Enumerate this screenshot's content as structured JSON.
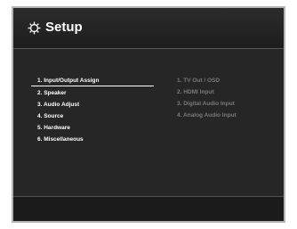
{
  "header": {
    "title": "Setup",
    "icon": "gear-icon"
  },
  "main_menu": {
    "selected_index": 0,
    "items": [
      {
        "label": "1. Input/Output Assign"
      },
      {
        "label": "2. Speaker"
      },
      {
        "label": "3. Audio Adjust"
      },
      {
        "label": "4. Source"
      },
      {
        "label": "5. Hardware"
      },
      {
        "label": "6. Miscellaneous"
      }
    ]
  },
  "sub_menu": {
    "items": [
      {
        "label": "1. TV Out / OSD"
      },
      {
        "label": "2. HDMI Input"
      },
      {
        "label": "3. Digital Audio Input"
      },
      {
        "label": "4. Analog Audio Input"
      }
    ]
  },
  "colors": {
    "background": "#252525",
    "border": "#b4b4b4",
    "active_text": "#ffffff",
    "inactive_text": "#7a7a7a"
  }
}
